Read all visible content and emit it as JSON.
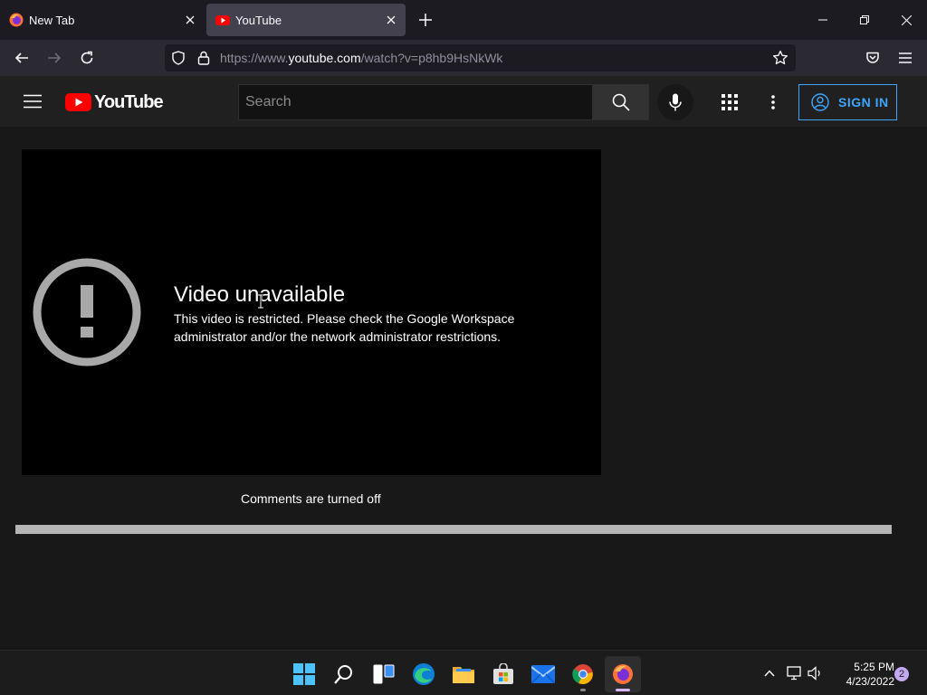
{
  "browser": {
    "tabs": [
      {
        "title": "New Tab",
        "active": false,
        "favicon": "firefox-icon"
      },
      {
        "title": "YouTube",
        "active": true,
        "favicon": "youtube-icon"
      }
    ],
    "url": {
      "prefix": "https://www.",
      "domain": "youtube.com",
      "path": "/watch?v=p8hb9HsNkWk"
    },
    "colors": {
      "tab_strip": "#1c1b22",
      "active_tab": "#42414d",
      "toolbar": "#2b2a33"
    }
  },
  "youtube": {
    "logo_text": "YouTube",
    "search_placeholder": "Search",
    "sign_in_label": "SIGN IN",
    "error_title": "Video unavailable",
    "error_message": "This video is restricted. Please check the Google Workspace administrator and/or the network administrator restrictions.",
    "comments_status": "Comments are turned off",
    "colors": {
      "brand_red": "#ff0000",
      "accent_blue": "#3ea6ff",
      "background": "#181818"
    }
  },
  "taskbar": {
    "apps": [
      "start-icon",
      "search-icon",
      "task-view-icon",
      "edge-icon",
      "file-explorer-icon",
      "store-icon",
      "mail-icon",
      "chrome-icon",
      "firefox-icon"
    ],
    "time": "5:25 PM",
    "date": "4/23/2022",
    "notification_count": "2"
  }
}
